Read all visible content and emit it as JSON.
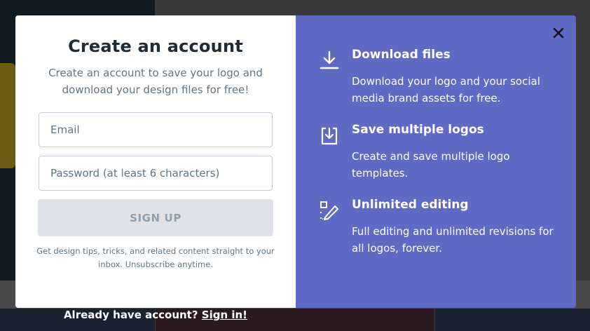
{
  "signup_modal": {
    "title": "Create an account",
    "subtitle": "Create an account to save your logo and download your design files for free!",
    "email": {
      "placeholder": "Email",
      "value": ""
    },
    "password": {
      "placeholder": "Password (at least 6 characters)",
      "value": ""
    },
    "signup_button": "SIGN UP",
    "fineprint": "Get design tips, tricks, and related content straight to your inbox. Unsubscribe anytime."
  },
  "features": [
    {
      "icon": "download-icon",
      "title": "Download files",
      "description": "Download your logo and your social media brand assets for free."
    },
    {
      "icon": "save-multiple-icon",
      "title": "Save multiple logos",
      "description": "Create and save multiple logo templates."
    },
    {
      "icon": "edit-pencil-icon",
      "title": "Unlimited editing",
      "description": "Full editing and unlimited revisions for all logos, forever."
    }
  ],
  "footer": {
    "prompt": "Already have account? ",
    "signin_link": "Sign in!"
  },
  "colors": {
    "accent_panel": "#5e6ac4",
    "title_text": "#212b36",
    "muted_text": "#637381",
    "disabled_button": "#dfe3e8"
  }
}
